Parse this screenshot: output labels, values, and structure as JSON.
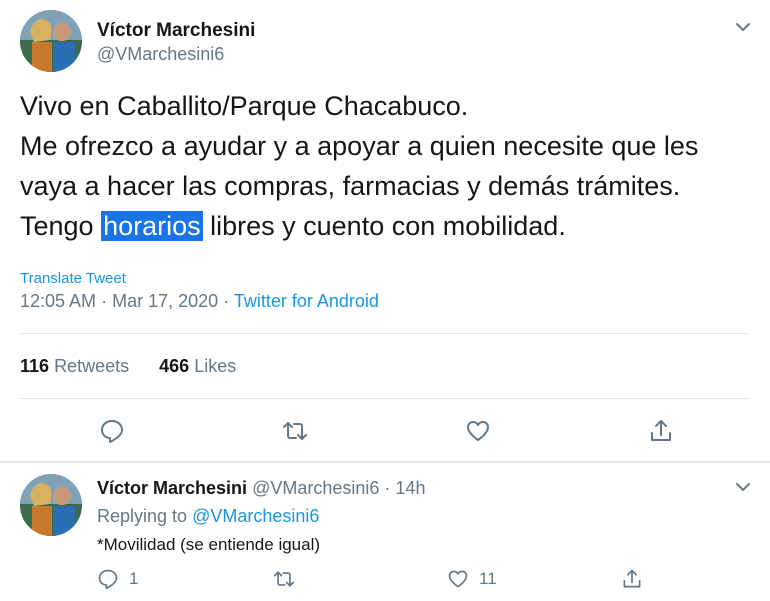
{
  "tweet": {
    "author_name": "Víctor Marchesini",
    "author_handle": "@VMarchesini6",
    "text_lines": {
      "l1": "Vivo en Caballito/Parque Chacabuco.",
      "l2": "Me ofrezco a ayudar y a apoyar a quien necesite que les",
      "l3": "vaya a hacer las compras, farmacias y demás trámites.",
      "l4_before": "Tengo ",
      "l4_highlight": "horarios",
      "l4_after": " libres y cuento con mobilidad."
    },
    "translate_label": "Translate Tweet",
    "time": "12:05 AM",
    "date": "Mar 17, 2020",
    "separator": "·",
    "source": "Twitter for Android",
    "retweets_count": "116",
    "retweets_label": "Retweets",
    "likes_count": "466",
    "likes_label": "Likes"
  },
  "reply": {
    "author_name": "Víctor Marchesini",
    "author_handle": "@VMarchesini6",
    "separator": "·",
    "age": "14h",
    "replying_label": "Replying to",
    "replying_to": "@VMarchesini6",
    "text": "*Movilidad (se entiende igual)",
    "reply_count": "1",
    "like_count": "11"
  },
  "icons": {
    "menu": "chevron-down-icon",
    "reply": "reply-icon",
    "retweet": "retweet-icon",
    "like": "heart-icon",
    "share": "share-icon"
  },
  "colors": {
    "link": "#1b95e0",
    "secondary_text": "#657786",
    "highlight": "#1a73e8",
    "divider": "#e1e8ed"
  }
}
